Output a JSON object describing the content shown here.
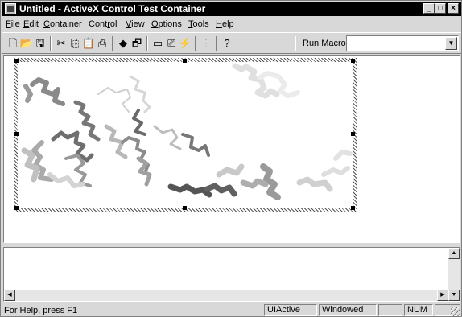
{
  "window": {
    "title": "Untitled - ActiveX Control Test Container",
    "controls": [
      "_",
      "□",
      "×"
    ]
  },
  "menu": [
    {
      "label": "File",
      "u": "F",
      "rest": "ile"
    },
    {
      "label": "Edit",
      "u": "E",
      "rest": "dit"
    },
    {
      "label": "Container",
      "u": "C",
      "rest": "ontainer"
    },
    {
      "label": "Control",
      "pre": "Cont",
      "u": "r",
      "rest": "ol"
    },
    {
      "label": "View",
      "u": "V",
      "rest": "iew"
    },
    {
      "label": "Options",
      "u": "O",
      "rest": "ptions"
    },
    {
      "label": "Tools",
      "u": "T",
      "rest": "ools"
    },
    {
      "label": "Help",
      "u": "H",
      "rest": "elp"
    }
  ],
  "toolbar": {
    "icons": [
      {
        "name": "new-icon",
        "glyph": "🗋"
      },
      {
        "name": "open-icon",
        "glyph": "📂"
      },
      {
        "name": "save-icon",
        "glyph": "🖫"
      },
      {
        "name": "cut-icon",
        "glyph": "✂"
      },
      {
        "name": "copy-icon",
        "glyph": "⎘"
      },
      {
        "name": "paste-icon",
        "glyph": "📋",
        "disabled": true
      },
      {
        "name": "insert-control-icon",
        "glyph": "⎙"
      },
      {
        "name": "invoke-methods-icon",
        "glyph": "◆"
      },
      {
        "name": "properties-icon",
        "glyph": "🗗"
      },
      {
        "name": "draw-metafile-icon",
        "glyph": "▭"
      },
      {
        "name": "events-icon",
        "glyph": "⎚"
      },
      {
        "name": "run-macro-icon",
        "glyph": "⚡"
      },
      {
        "name": "grid-icon",
        "glyph": "⋮",
        "disabled": true
      },
      {
        "name": "help-icon",
        "glyph": "?"
      }
    ],
    "run_macro_label": "Run Macro:",
    "run_macro_value": ""
  },
  "status": {
    "help_text": "For Help, press F1",
    "panes": [
      "UIActive",
      "Windowed",
      "",
      "NUM",
      ""
    ]
  }
}
